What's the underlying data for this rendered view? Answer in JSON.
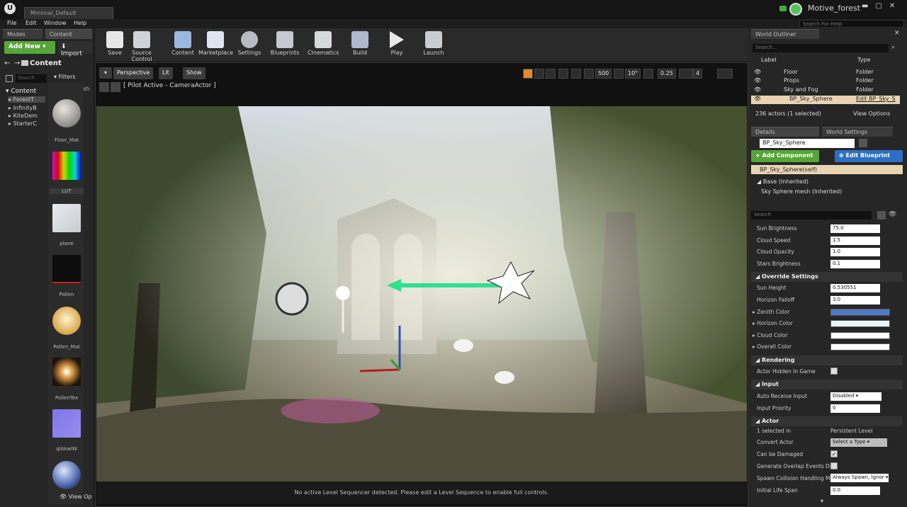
{
  "title_bar": {
    "tab": "Minimal_Default",
    "project": "Motive_forest",
    "logo": "U"
  },
  "menu": [
    "File",
    "Edit",
    "Window",
    "Help"
  ],
  "search_help_placeholder": "Search For Help",
  "left": {
    "tabs": [
      "Modes",
      "Content"
    ],
    "add_new": "Add New",
    "import": "Import",
    "breadcrumb": "Content",
    "search_placeholder": "Search",
    "filters": "Filters",
    "static_mesh": "Static Mesh",
    "tree": [
      "Content",
      "ForestT",
      "InfinityB",
      "KiteDem",
      "StarterC"
    ],
    "assets": [
      "Floor_Mat",
      "LUT",
      "plane",
      "Pollen",
      "Pollen_Mat",
      "PollenTex",
      "qlAkwlW",
      "View Op"
    ]
  },
  "toolbar": [
    "Save",
    "Source Control",
    "Content",
    "Marketplace",
    "Settings",
    "Blueprints",
    "Cinematics",
    "Build",
    "Play",
    "Launch"
  ],
  "viewport": {
    "perspective": "Perspective",
    "lit": "Lit",
    "show": "Show",
    "pilot": "[ Pilot Active - CameraActor ]",
    "grid": "500",
    "rot": "10°",
    "scale": "0.25",
    "cam": "4",
    "sequencer": "No active Level Sequencer detected. Please edit a Level Sequence to enable full controls."
  },
  "outliner": {
    "tab": "World Outliner",
    "search_placeholder": "Search...",
    "col_label": "Label",
    "col_type": "Type",
    "rows": [
      {
        "label": "Floor",
        "type": "Folder"
      },
      {
        "label": "Props",
        "type": "Folder"
      },
      {
        "label": "Sky and Fog",
        "type": "Folder"
      },
      {
        "label": "BP_Sky_Sphere",
        "type": "Edit BP_Sky_S"
      }
    ],
    "count": "236 actors (1 selected)",
    "view_options": "View Options"
  },
  "details": {
    "tabs": [
      "Details",
      "World Settings"
    ],
    "actor_name": "BP_Sky_Sphere",
    "add_component": "Add Component",
    "edit_blueprint": "Edit Blueprint",
    "self": "BP_Sky_Sphere(self)",
    "base": "Base (Inherited)",
    "mesh": "Sky Sphere mesh (Inherited)",
    "search_placeholder": "Search",
    "props1": [
      [
        "Sun Brightness",
        "75.0"
      ],
      [
        "Cloud Speed",
        "1.5"
      ],
      [
        "Cloud Opacity",
        "1.0"
      ],
      [
        "Stars Brightness",
        "0.1"
      ]
    ],
    "override": "Override Settings",
    "props2": [
      [
        "Sun Height",
        "0.530551"
      ],
      [
        "Horizon Falloff",
        "3.0"
      ]
    ],
    "colors": [
      [
        "Zenith Color",
        "#4f79c4"
      ],
      [
        "Horizon Color",
        "#e9f4fa"
      ],
      [
        "Cloud Color",
        "#ffffff"
      ],
      [
        "Overall Color",
        "#ffffff"
      ]
    ],
    "rendering": "Rendering",
    "actor_hidden": "Actor Hidden In Game",
    "input": "Input",
    "auto_receive": "Auto Receive Input",
    "auto_receive_val": "Disabled",
    "input_priority": "Input Priority",
    "input_priority_val": "0",
    "actor": "Actor",
    "selected_in": "1 selected in",
    "selected_in_val": "Persistent Level",
    "convert": "Convert Actor",
    "convert_val": "Select a Type",
    "can_damage": "Can be Damaged",
    "gen_overlap": "Generate Overlap Events Duri",
    "spawn_coll": "Spawn Collision Handling Met",
    "spawn_coll_val": "Always Spawn, Ignor",
    "life_span": "Initial Life Span",
    "life_span_val": "0.0"
  }
}
